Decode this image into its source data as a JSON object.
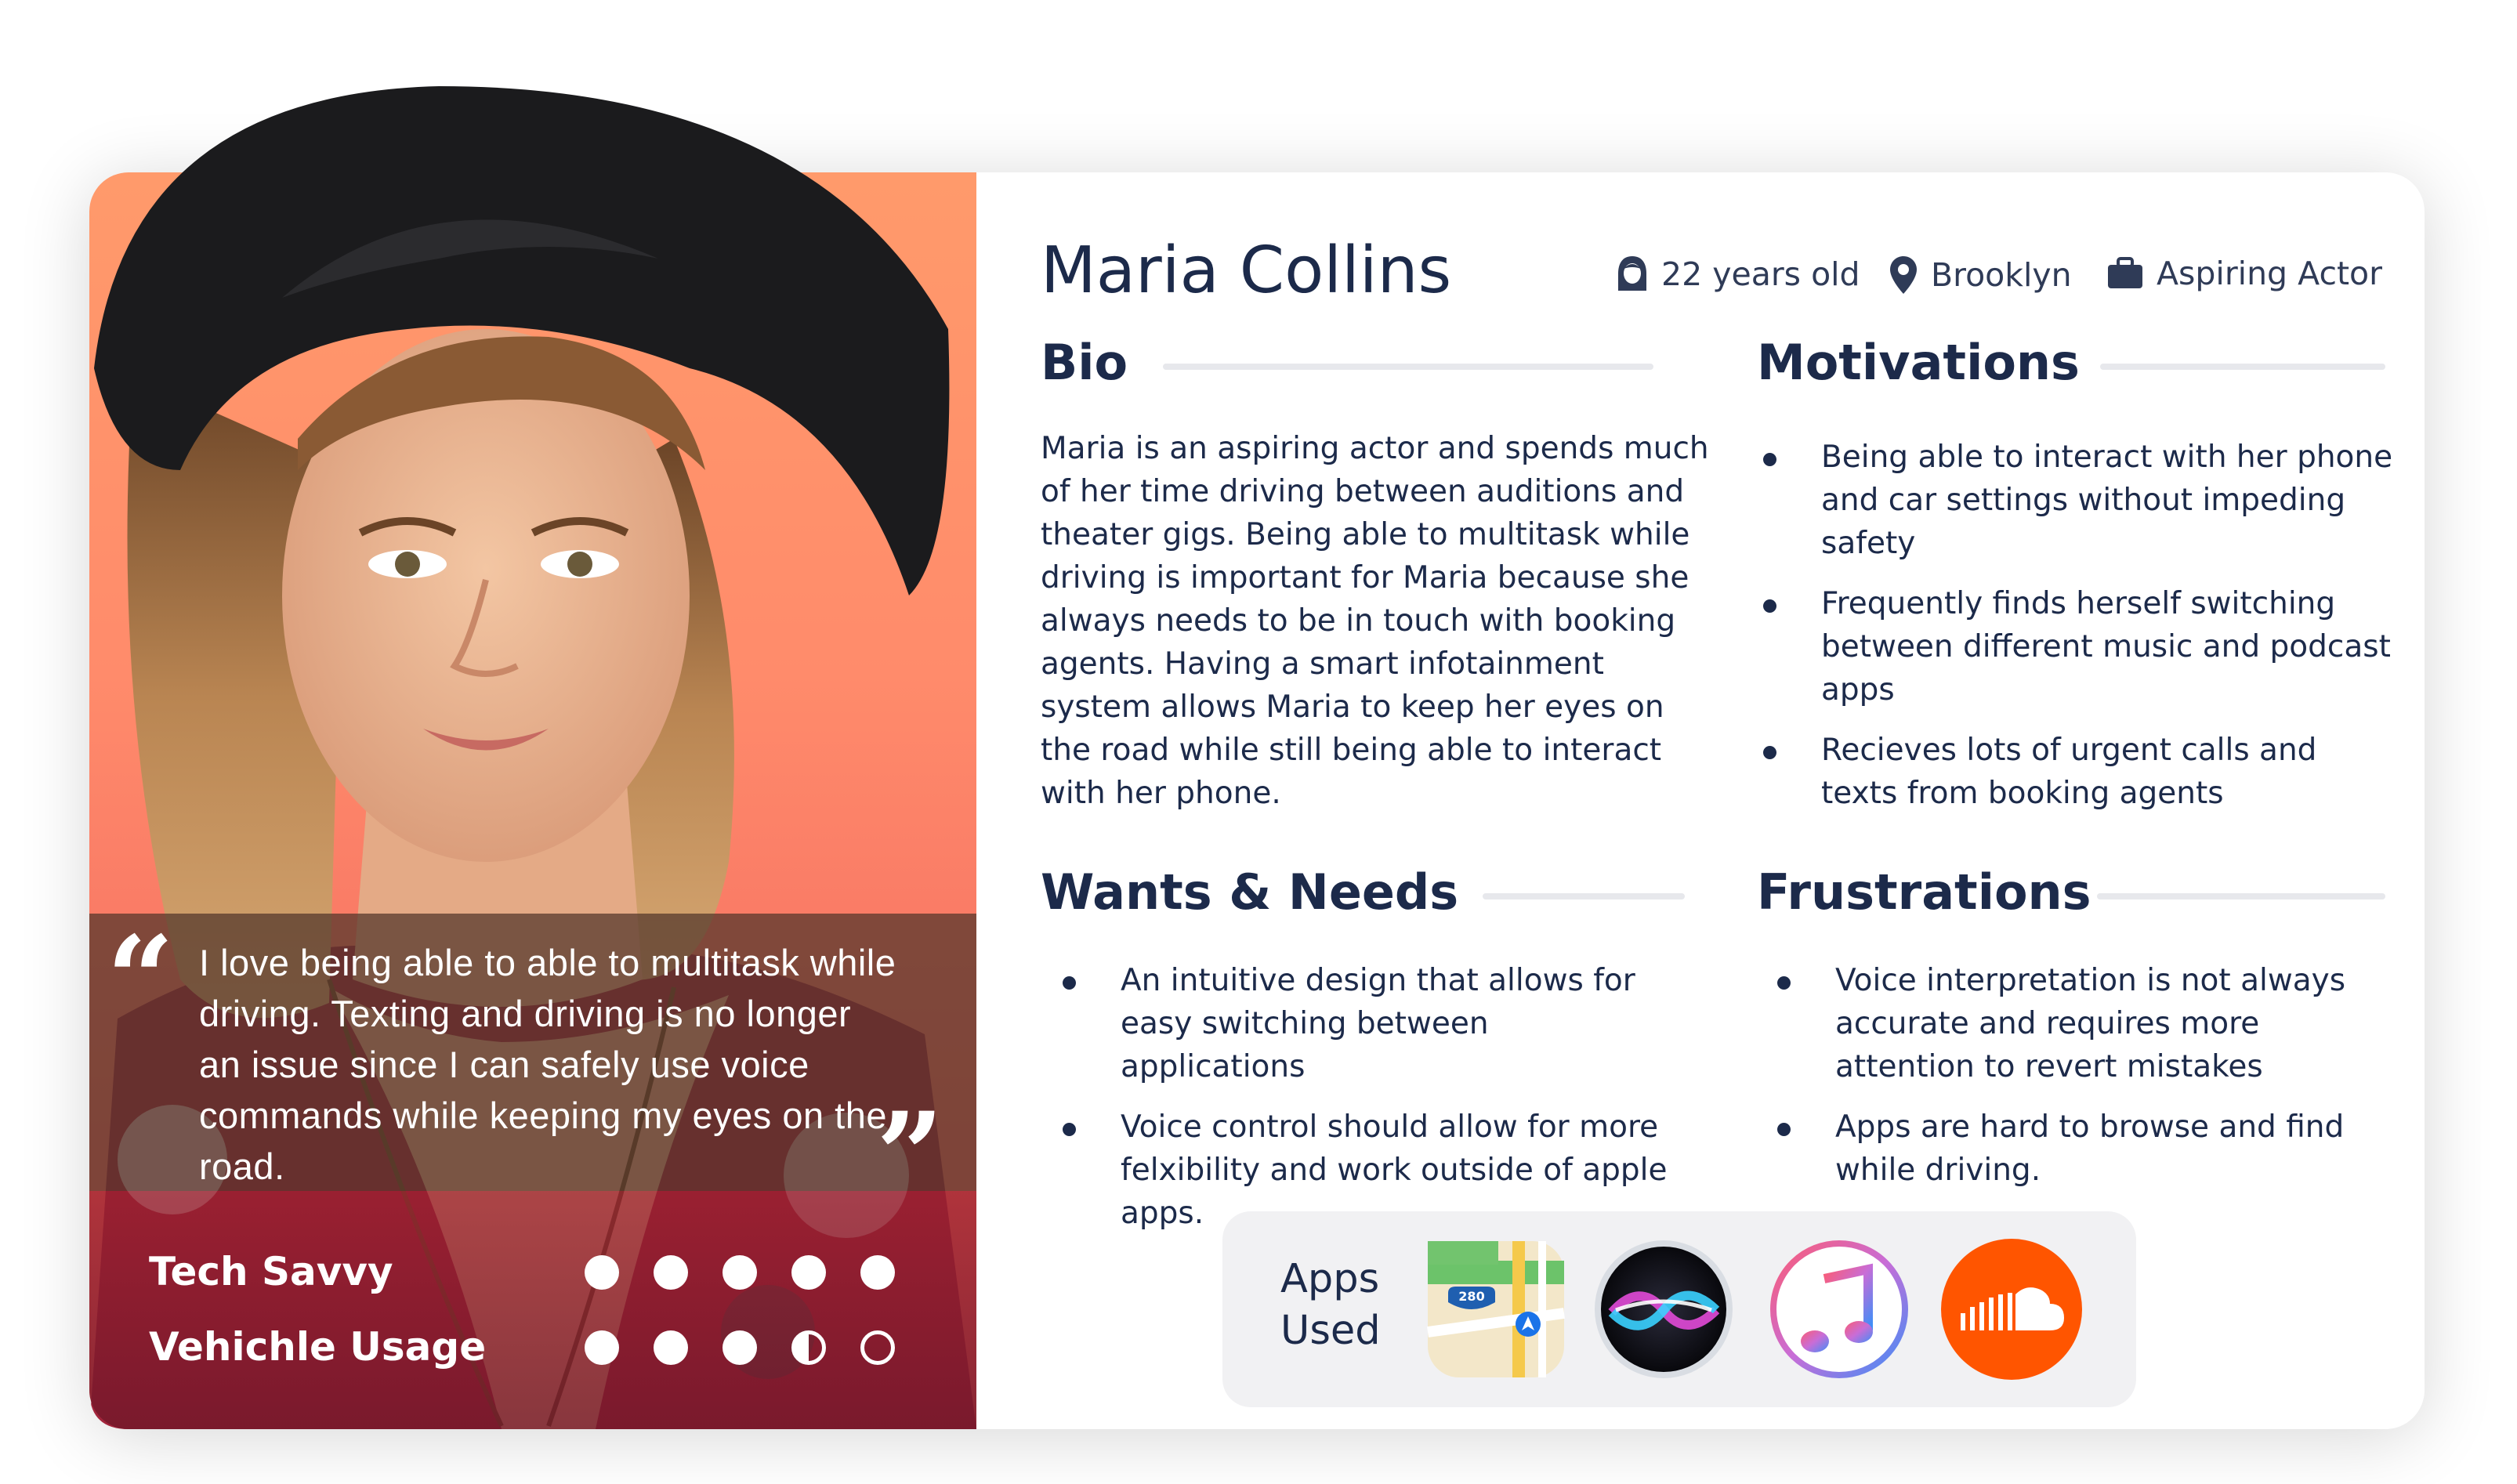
{
  "persona": {
    "name": "Maria Collins",
    "age": "22 years old",
    "location": "Brooklyn",
    "occupation": "Aspiring Actor"
  },
  "quote": {
    "open_mark": "“",
    "text": "I love being able to able to multitask while driving. Texting and driving is no longer an issue since I can safely use voice commands while keeping my eyes on the road.",
    "close_mark": "”"
  },
  "stats": [
    {
      "label": "Tech Savvy",
      "rating": 5,
      "max": 5
    },
    {
      "label": "Vehichle Usage",
      "rating": 3.5,
      "max": 5
    }
  ],
  "bio": {
    "title": "Bio",
    "text": "Maria is an aspiring actor and spends much of her time driving between auditions and theater gigs. Being able to multitask while driving is important for Maria because she always needs to be in touch with booking agents. Having a smart infotainment system allows Maria to keep her eyes on the road while still being able to interact with her phone."
  },
  "motivations": {
    "title": "Motivations",
    "items": [
      "Being able to interact with her phone and car settings without impeding safety",
      "Frequently finds herself switching between different music and podcast apps",
      "Recieves lots of urgent calls and texts from booking agents"
    ]
  },
  "wants": {
    "title": "Wants & Needs",
    "items": [
      "An intuitive design that allows for easy switching between applications",
      "Voice control should allow for more felxibility and work outside of apple apps."
    ]
  },
  "frustrations": {
    "title": "Frustrations",
    "items": [
      "Voice interpretation is not always accurate and requires more attention to revert mistakes",
      "Apps are hard to browse and find while driving."
    ]
  },
  "apps": {
    "label": "Apps Used",
    "map_shield": "280",
    "icons": [
      "maps-icon",
      "siri-icon",
      "itunes-icon",
      "soundcloud-icon"
    ]
  },
  "colors": {
    "text": "#1c2a4a",
    "photo_gradient_top": "#ff9a6b",
    "photo_gradient_bottom": "#e8605f",
    "soundcloud": "#ff5500"
  }
}
